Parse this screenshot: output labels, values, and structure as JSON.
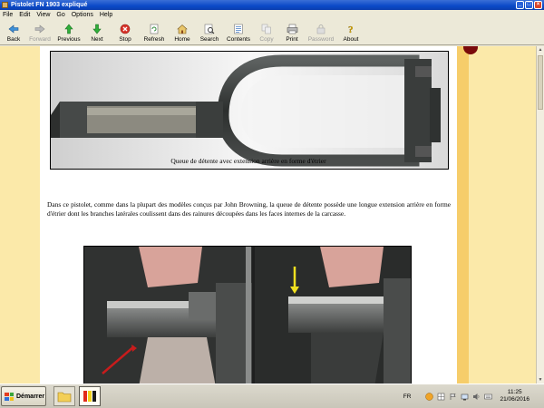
{
  "window": {
    "title": "Pistolet FN 1903 expliqué"
  },
  "menu": [
    "File",
    "Edit",
    "View",
    "Go",
    "Options",
    "Help"
  ],
  "toolbar": [
    {
      "label": "Back",
      "icon": "back-arrow-icon",
      "enabled": true
    },
    {
      "label": "Forward",
      "icon": "forward-arrow-icon",
      "enabled": false
    },
    {
      "label": "Previous",
      "icon": "previous-icon",
      "enabled": true
    },
    {
      "label": "Next",
      "icon": "next-icon",
      "enabled": true
    },
    {
      "label": "Stop",
      "icon": "stop-icon",
      "enabled": true
    },
    {
      "label": "Refresh",
      "icon": "refresh-icon",
      "enabled": true
    },
    {
      "label": "Home",
      "icon": "home-icon",
      "enabled": true
    },
    {
      "label": "Search",
      "icon": "search-icon",
      "enabled": true
    },
    {
      "label": "Contents",
      "icon": "contents-icon",
      "enabled": true
    },
    {
      "label": "Copy",
      "icon": "copy-icon",
      "enabled": false
    },
    {
      "label": "Print",
      "icon": "print-icon",
      "enabled": true
    },
    {
      "label": "Password",
      "icon": "password-icon",
      "enabled": false
    },
    {
      "label": "About",
      "icon": "about-icon",
      "enabled": true
    }
  ],
  "article": {
    "caption": "Queue de détente avec extension arrière en forme d'étrier",
    "paragraph": "Dans ce pistolet, comme dans la plupart des modèles conçus par John Browning, la queue de détente possède une longue extension arrière en forme d'étrier dont les branches latérales coulissent dans des rainures découpées dans les faces internes de la carcasse."
  },
  "taskbar": {
    "start_label": "Démarrer",
    "language": "FR",
    "time": "11:25",
    "date": "21/06/2016"
  },
  "colors": {
    "page_background": "#fbe9a9",
    "rail": "#f6cd6a"
  }
}
